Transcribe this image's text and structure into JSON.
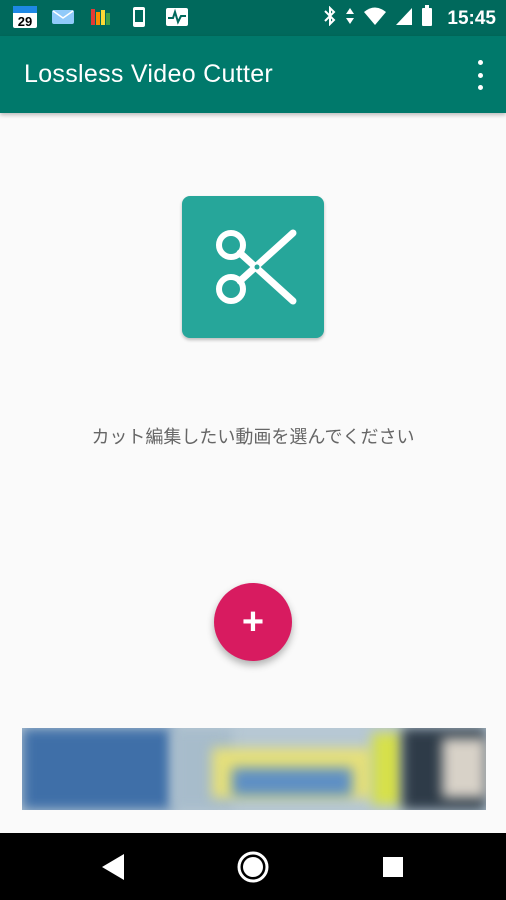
{
  "status_bar": {
    "calendar_day": "29",
    "time": "15:45",
    "icons": [
      "calendar-icon",
      "mail-icon",
      "equalizer-icon",
      "phone-icon",
      "activity-icon",
      "bluetooth-icon",
      "data-arrows-icon",
      "wifi-icon",
      "signal-icon",
      "battery-icon"
    ]
  },
  "app_bar": {
    "title": "Lossless Video Cutter",
    "menu_icon": "more-vert-icon"
  },
  "main": {
    "logo_icon": "scissors-icon",
    "prompt": "カット編集したい動画を選んでください",
    "fab_label": "+"
  },
  "nav_bar": {
    "icons": [
      "back-icon",
      "home-icon",
      "recents-icon"
    ]
  },
  "colors": {
    "status_bar": "#00695c",
    "app_bar": "#00796b",
    "logo_tile": "#26a69a",
    "fab": "#d81b60",
    "background": "#fafafa"
  }
}
